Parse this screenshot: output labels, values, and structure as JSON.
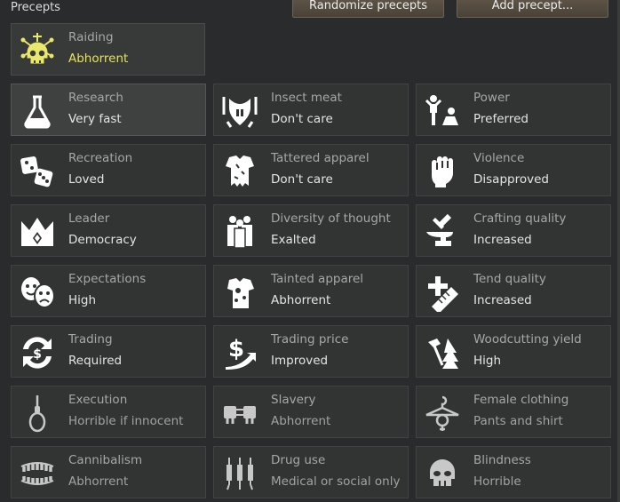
{
  "header": {
    "title": "Precepts",
    "randomize_label": "Randomize precepts",
    "add_label": "Add precept..."
  },
  "featured": {
    "name": "Raiding",
    "value": "Abhorrent",
    "icon": "skull-icon"
  },
  "precepts": [
    {
      "name": "Research",
      "value": "Very fast",
      "icon": "flask-icon"
    },
    {
      "name": "Insect meat",
      "value": "Don't care",
      "icon": "insect-icon"
    },
    {
      "name": "Power",
      "value": "Preferred",
      "icon": "power-icon"
    },
    {
      "name": "Recreation",
      "value": "Loved",
      "icon": "dice-icon"
    },
    {
      "name": "Tattered apparel",
      "value": "Don't care",
      "icon": "tattered-apparel-icon"
    },
    {
      "name": "Violence",
      "value": "Disapproved",
      "icon": "fist-icon"
    },
    {
      "name": "Leader",
      "value": "Democracy",
      "icon": "crown-icon"
    },
    {
      "name": "Diversity of thought",
      "value": "Exalted",
      "icon": "people-icon"
    },
    {
      "name": "Crafting quality",
      "value": "Increased",
      "icon": "anvil-icon"
    },
    {
      "name": "Expectations",
      "value": "High",
      "icon": "masks-icon"
    },
    {
      "name": "Tainted apparel",
      "value": "Abhorrent",
      "icon": "tainted-apparel-icon"
    },
    {
      "name": "Tend quality",
      "value": "Increased",
      "icon": "bandage-icon"
    },
    {
      "name": "Trading",
      "value": "Required",
      "icon": "trading-icon"
    },
    {
      "name": "Trading price",
      "value": "Improved",
      "icon": "trading-price-icon"
    },
    {
      "name": "Woodcutting yield",
      "value": "High",
      "icon": "axe-tree-icon"
    },
    {
      "name": "Execution",
      "value": "Horrible if innocent",
      "icon": "noose-icon"
    },
    {
      "name": "Slavery",
      "value": "Abhorrent",
      "icon": "shackles-icon"
    },
    {
      "name": "Female clothing",
      "value": "Pants and shirt",
      "icon": "hanger-icon"
    },
    {
      "name": "Cannibalism",
      "value": "Abhorrent",
      "icon": "teeth-icon"
    },
    {
      "name": "Drug use",
      "value": "Medical or social only",
      "icon": "syringe-icon"
    },
    {
      "name": "Blindness",
      "value": "Horrible",
      "icon": "skull-blind-icon"
    }
  ]
}
